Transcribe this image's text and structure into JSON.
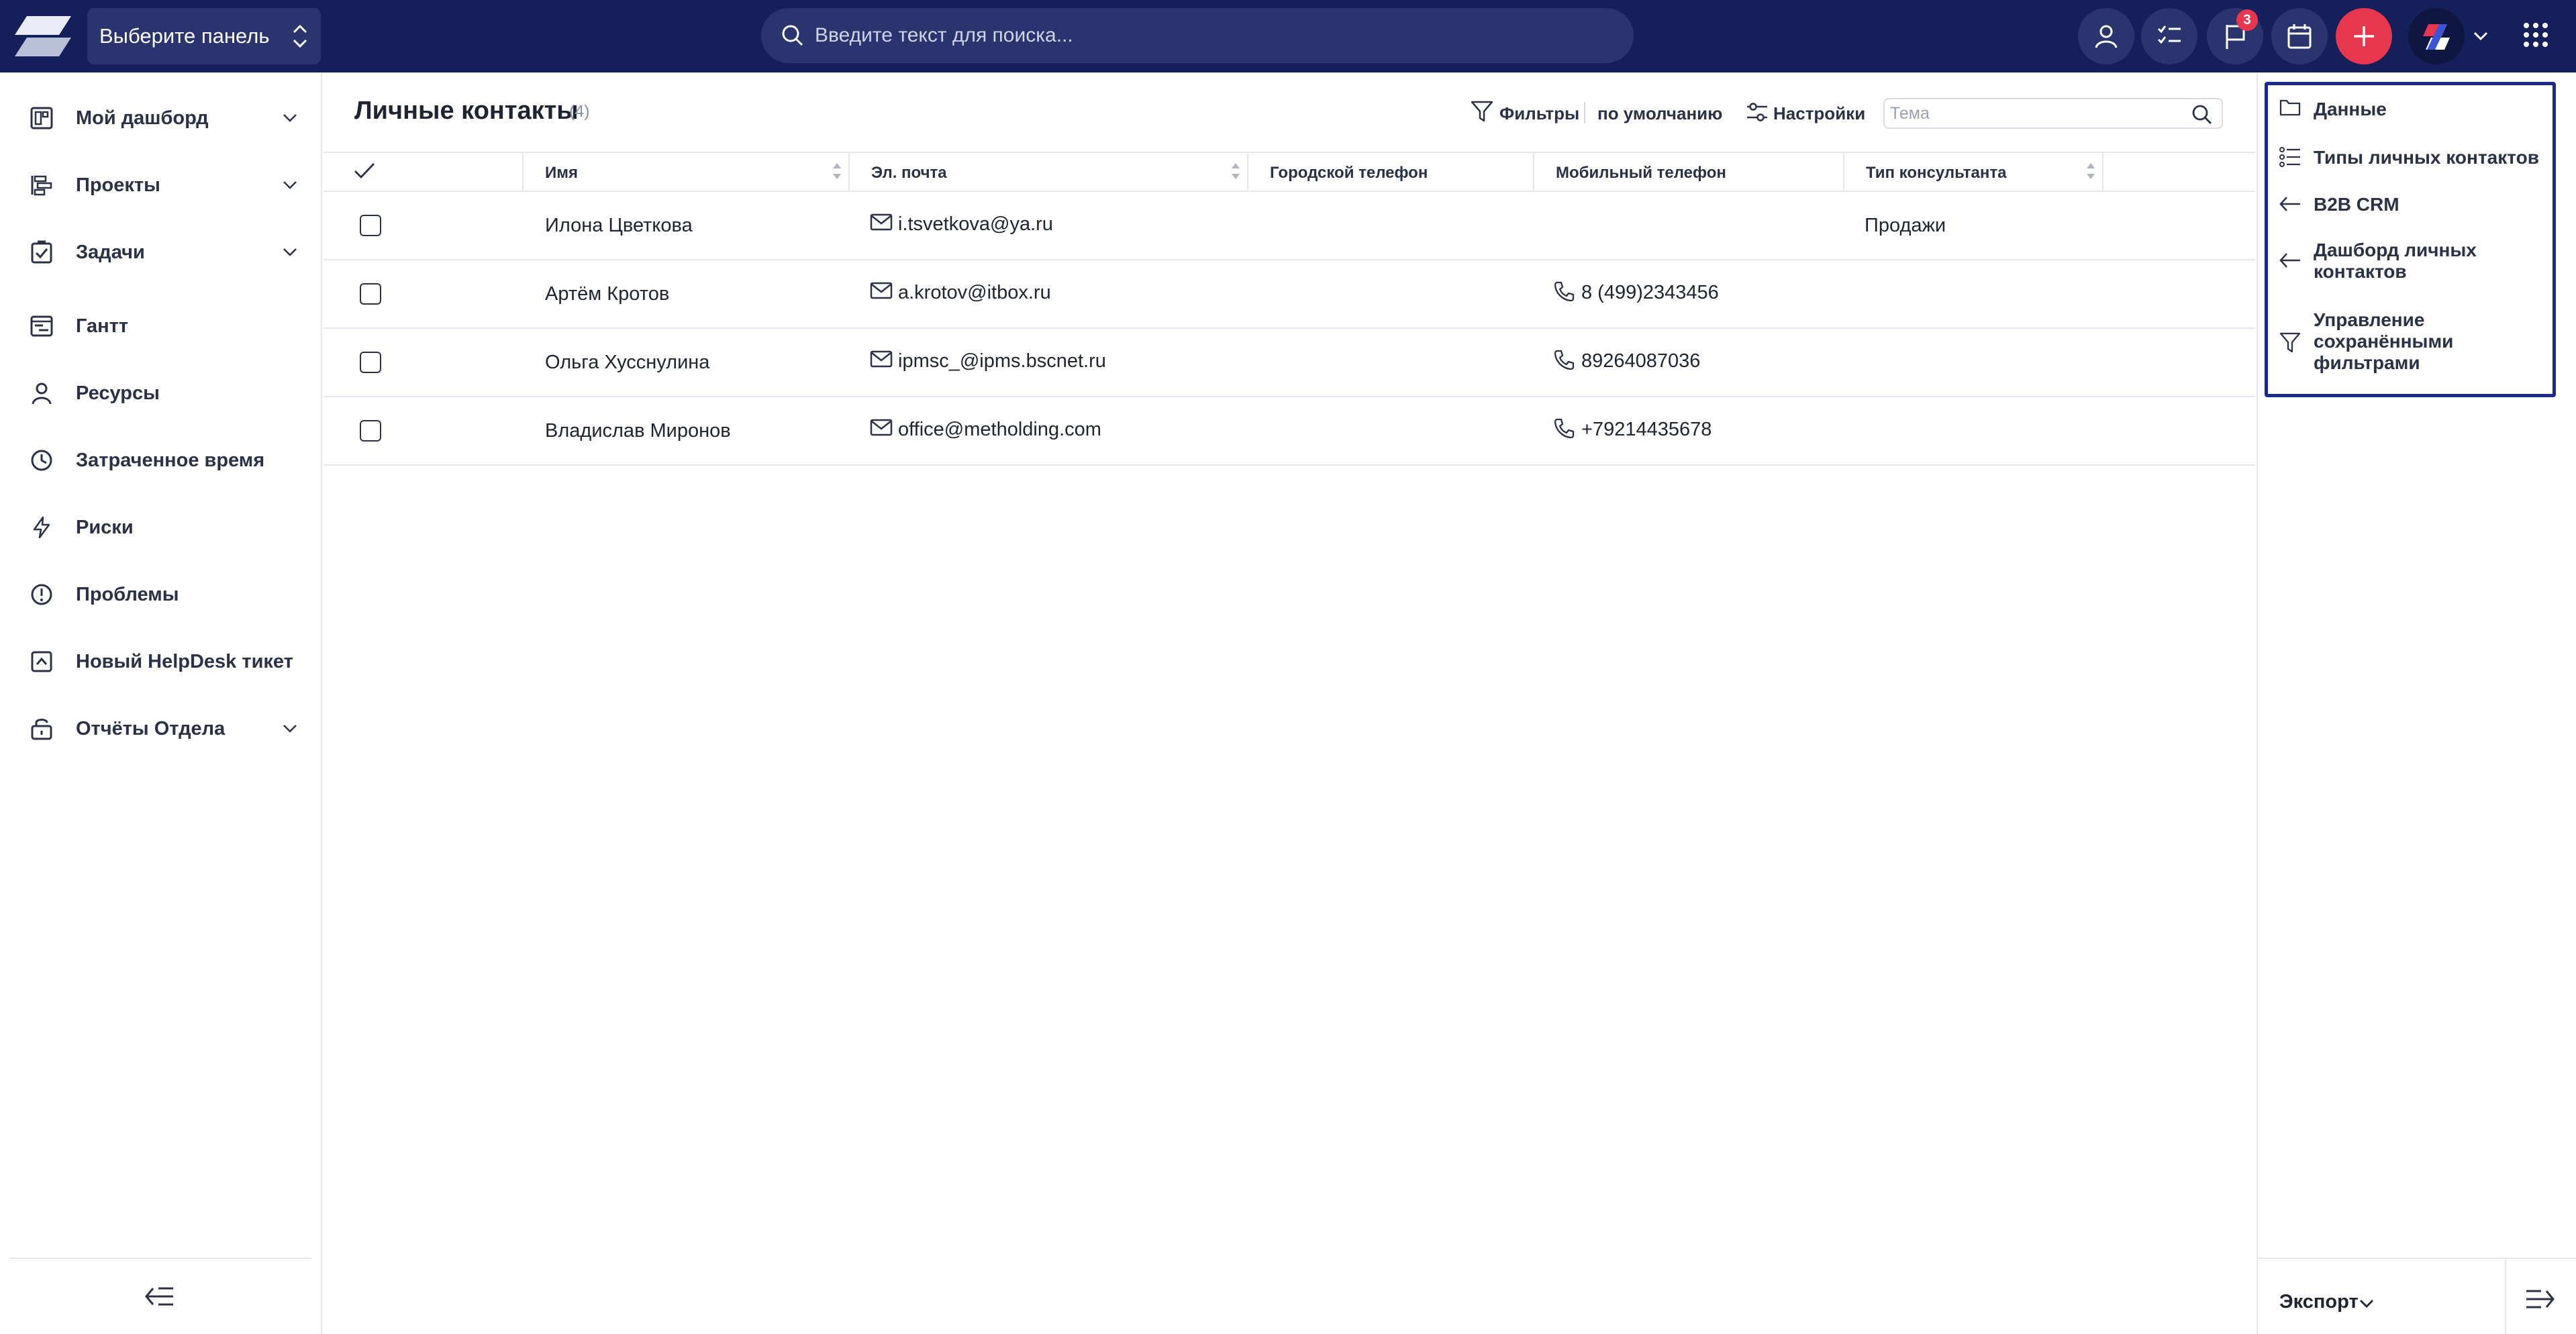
{
  "topbar": {
    "panel_select": "Выберите панель",
    "search_placeholder": "Введите текст для поиска...",
    "notifications_badge": "3",
    "accent_color": "#e8364f",
    "bar_color": "#15205a"
  },
  "sidebar": {
    "items": [
      {
        "label": "Мой дашборд",
        "icon": "dashboard-icon",
        "has_children": true
      },
      {
        "label": "Проекты",
        "icon": "projects-icon",
        "has_children": true
      },
      {
        "label": "Задачи",
        "icon": "tasks-icon",
        "has_children": true
      },
      {
        "label": "Гантт",
        "icon": "gantt-icon",
        "has_children": false
      },
      {
        "label": "Ресурсы",
        "icon": "person-icon",
        "has_children": false
      },
      {
        "label": "Затраченное время",
        "icon": "clock-icon",
        "has_children": false
      },
      {
        "label": "Риски",
        "icon": "lightning-icon",
        "has_children": false
      },
      {
        "label": "Проблемы",
        "icon": "alert-circle-icon",
        "has_children": false
      },
      {
        "label": "Новый HelpDesk тикет",
        "icon": "ticket-icon",
        "has_children": false
      },
      {
        "label": "Отчёты Отдела",
        "icon": "reports-icon",
        "has_children": true
      }
    ]
  },
  "main": {
    "title": "Личные контакты",
    "count": "(4)",
    "filters_label": "Фильтры",
    "default_label": "по умолчанию",
    "settings_label": "Настройки",
    "topic_placeholder": "Тема",
    "columns": [
      "Имя",
      "Эл. почта",
      "Городской телефон",
      "Мобильный телефон",
      "Тип консультанта"
    ],
    "rows": [
      {
        "name": "Илона Цветкова",
        "email": "i.tsvetkova@ya.ru",
        "city_phone": "",
        "mobile": "",
        "type": "Продажи"
      },
      {
        "name": "Артём Кротов",
        "email": "a.krotov@itbox.ru",
        "city_phone": "",
        "mobile": "8 (499)2343456",
        "type": ""
      },
      {
        "name": "Ольга Хусснулина",
        "email": "ipmsc_@ipms.bscnet.ru",
        "city_phone": "",
        "mobile": "89264087036",
        "type": ""
      },
      {
        "name": "Владислав Миронов",
        "email": "office@metholding.com",
        "city_phone": "",
        "mobile": "+79214435678",
        "type": ""
      }
    ]
  },
  "right_panel": {
    "items": [
      {
        "label": "Данные",
        "icon": "folder-icon"
      },
      {
        "label": "Типы личных контактов",
        "icon": "list-icon"
      },
      {
        "label": "B2B CRM",
        "icon": "arrow-left-icon"
      },
      {
        "label": "Дашборд личных контактов",
        "icon": "arrow-left-icon"
      },
      {
        "label": "Управление сохранёнными фильтрами",
        "icon": "filter-icon"
      }
    ],
    "export_label": "Экспорт"
  }
}
